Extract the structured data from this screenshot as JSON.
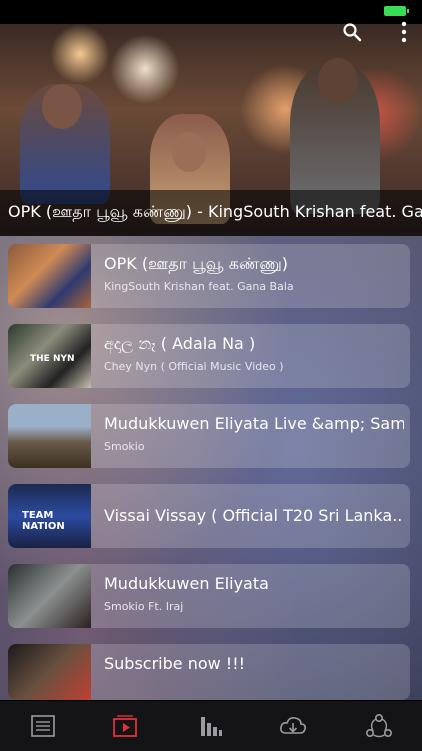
{
  "status": {
    "battery_color": "#3adb55"
  },
  "header": {
    "icons": {
      "search": "search-icon",
      "more": "more-vertical-icon"
    }
  },
  "hero": {
    "caption": "OPK (ஊதா பூவூ கண்ணு) - KingSouth Krishan feat. Gana Bala"
  },
  "videos": [
    {
      "title": "OPK (ஊதா பூவூ கண்ணு)",
      "subtitle": "KingSouth Krishan feat. Gana Bala"
    },
    {
      "title": "අදාල නෑ ( Adala Na )",
      "subtitle": "Chey Nyn ( Official Music Video )"
    },
    {
      "title": "Mudukkuwen Eliyata Live &amp; SamaJ",
      "subtitle": "Smokio"
    },
    {
      "title": "Vissai Vissay ( Official T20 Sri Lanka...",
      "subtitle": ""
    },
    {
      "title": "Mudukkuwen Eliyata",
      "subtitle": "Smokio Ft. Iraj"
    },
    {
      "title": "Subscribe now !!!",
      "subtitle": ""
    }
  ],
  "thumb_text": {
    "t2": "THE NYN",
    "t4": "TEAM NATION"
  },
  "tabbar": {
    "accent": "#e0313a",
    "tabs": [
      {
        "icon": "list-icon",
        "active": false
      },
      {
        "icon": "video-play-icon",
        "active": true
      },
      {
        "icon": "equalizer-icon",
        "active": false
      },
      {
        "icon": "cloud-download-icon",
        "active": false
      },
      {
        "icon": "share-icon",
        "active": false
      }
    ]
  }
}
